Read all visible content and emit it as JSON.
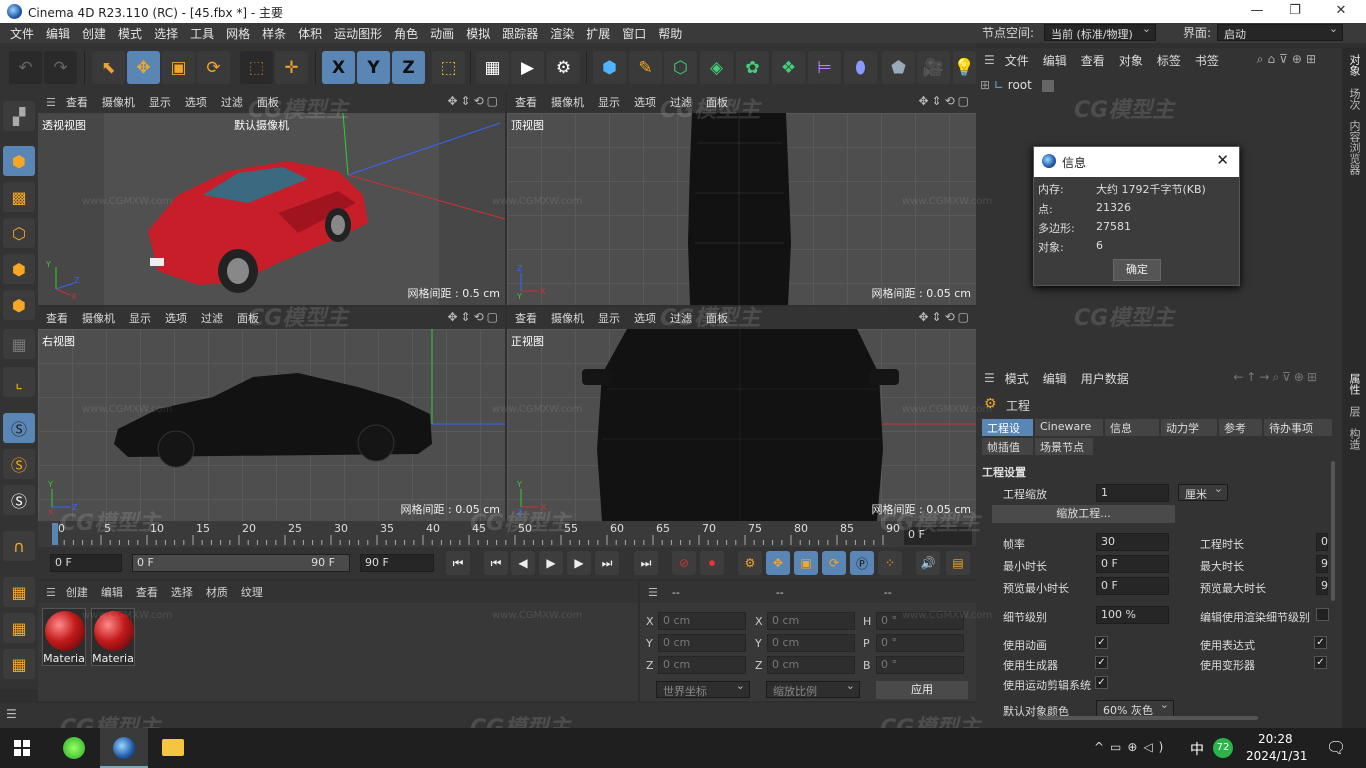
{
  "window": {
    "title": "Cinema 4D R23.110 (RC) - [45.fbx *] - 主要",
    "controls": [
      "—",
      "❐",
      "✕"
    ]
  },
  "menu": [
    "文件",
    "编辑",
    "创建",
    "模式",
    "选择",
    "工具",
    "网格",
    "样条",
    "体积",
    "运动图形",
    "角色",
    "动画",
    "模拟",
    "跟踪器",
    "渲染",
    "扩展",
    "窗口",
    "帮助"
  ],
  "node_space": {
    "label": "节点空间:",
    "value": "当前 (标准/物理)"
  },
  "interface": {
    "label": "界面:",
    "value": "启动"
  },
  "toolbar": {
    "undo": "↶",
    "redo": "↷",
    "live_select": "⬉",
    "move": "✥",
    "scale": "▣",
    "rotate": "⟳",
    "x": "X",
    "y": "Y",
    "z": "Z",
    "coord": "⬚",
    "render_view": "▦",
    "render": "▶",
    "render_settings": "⚙",
    "cube": "⬢",
    "pen": "✎",
    "subdivision": "⬡",
    "extrude": "◈",
    "cloner": "✿",
    "deformer": "❖",
    "field": "⊨",
    "floor": "⬟",
    "camera": "🎥",
    "light": "💡"
  },
  "viewports": {
    "menu": [
      "查看",
      "摄像机",
      "显示",
      "选项",
      "过滤",
      "面板"
    ],
    "tl": {
      "name": "透视视图",
      "camera": "默认摄像机",
      "grid": "网格间距 : 0.5 cm"
    },
    "tr": {
      "name": "顶视图",
      "grid": "网格间距 : 0.05 cm"
    },
    "bl": {
      "name": "右视图",
      "grid": "网格间距 : 0.05 cm"
    },
    "br": {
      "name": "正视图",
      "grid": "网格间距 : 0.05 cm"
    }
  },
  "timeline": {
    "ticks": [
      "0",
      "5",
      "10",
      "15",
      "20",
      "25",
      "30",
      "35",
      "40",
      "45",
      "50",
      "55",
      "60",
      "65",
      "70",
      "75",
      "80",
      "85",
      "90"
    ],
    "end_label": "0 F"
  },
  "transport": {
    "start": "0 F",
    "current": "0 F",
    "range_end": "90 F",
    "end": "90 F"
  },
  "material_manager": {
    "menu": [
      "创建",
      "编辑",
      "查看",
      "选择",
      "材质",
      "纹理"
    ],
    "materials": [
      "Materia",
      "Materia"
    ]
  },
  "coords": {
    "headers": [
      "--",
      "--",
      "--"
    ],
    "rows": [
      {
        "a": "X",
        "av": "0 cm",
        "b": "X",
        "bv": "0 cm",
        "c": "H",
        "cv": "0 °"
      },
      {
        "a": "Y",
        "av": "0 cm",
        "b": "Y",
        "bv": "0 cm",
        "c": "P",
        "cv": "0 °"
      },
      {
        "a": "Z",
        "av": "0 cm",
        "b": "Z",
        "bv": "0 cm",
        "c": "B",
        "cv": "0 °"
      }
    ],
    "world": "世界坐标",
    "scale": "缩放比例",
    "apply": "应用"
  },
  "object_manager": {
    "menu": [
      "文件",
      "编辑",
      "查看",
      "对象",
      "标签",
      "书签"
    ],
    "root": "root"
  },
  "dialog": {
    "title": "信息",
    "rows": [
      {
        "k": "内存:",
        "v": "大约 1792千字节(KB)"
      },
      {
        "k": "点:",
        "v": "21326"
      },
      {
        "k": "多边形:",
        "v": "27581"
      },
      {
        "k": "对象:",
        "v": "6"
      }
    ],
    "ok": "确定"
  },
  "attributes": {
    "menu": [
      "模式",
      "编辑",
      "用户数据"
    ],
    "object": "工程",
    "tabs": [
      "工程设置",
      "Cineware",
      "信息",
      "动力学",
      "参考",
      "待办事项",
      "帧插值",
      "场景节点"
    ],
    "section": "工程设置",
    "scale_label": "工程缩放",
    "scale_value": "1",
    "scale_unit": "厘米",
    "scale_btn": "缩放工程...",
    "fps_label": "帧率",
    "fps_value": "30",
    "proj_len": "工程时长",
    "proj_len_v": "0",
    "min_label": "最小时长",
    "min_value": "0 F",
    "max_label": "最大时长",
    "max_value": "9",
    "pmin_label": "预览最小时长",
    "pmin_value": "0 F",
    "pmax_label": "预览最大时长",
    "pmax_value": "9",
    "lod_label": "细节级别",
    "lod_value": "100 %",
    "lod_render": "编辑使用渲染细节级别",
    "anim": "使用动画",
    "expr": "使用表达式",
    "gen": "使用生成器",
    "deform": "使用变形器",
    "motion": "使用运动剪辑系统",
    "color_label": "默认对象颜色",
    "color_value": "60% 灰色"
  },
  "right_tabs": [
    "对象",
    "场次",
    "内容浏览器",
    "属性",
    "层",
    "构造"
  ],
  "taskbar": {
    "time": "20:28",
    "date": "2024/1/31",
    "ime": "中",
    "badge": "72"
  },
  "watermark": "CG模型主",
  "watermark_url": "www.CGMXW.com"
}
